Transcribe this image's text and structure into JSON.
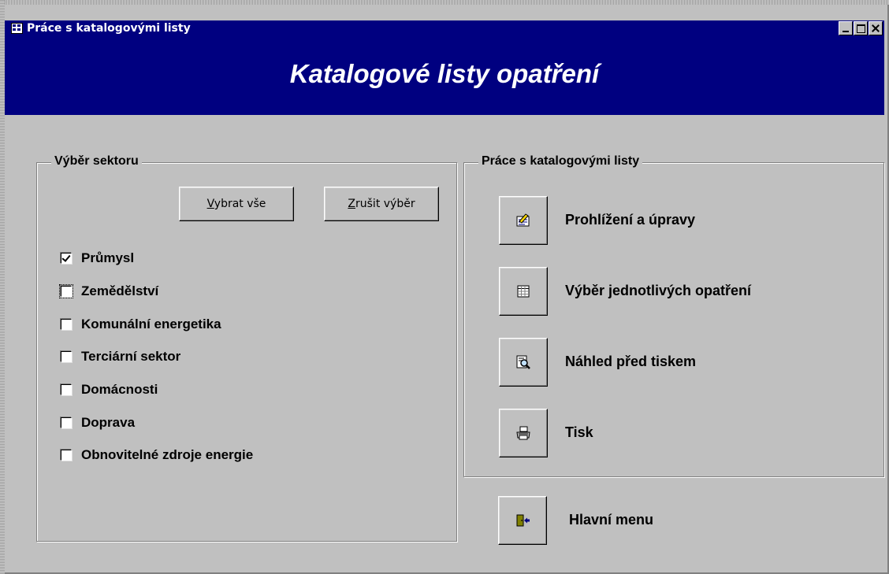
{
  "window": {
    "title": "Práce s katalogovými listy",
    "controls": {
      "minimize": "minimize",
      "maximize": "maximize",
      "close": "close"
    }
  },
  "header": {
    "title": "Katalogové listy opatření"
  },
  "sector_group": {
    "label": "Výběr sektoru",
    "select_all": {
      "accel": "V",
      "rest": "ybrat vše"
    },
    "clear_selection": {
      "accel": "Z",
      "rest": "rušit výběr"
    },
    "items": [
      {
        "label": "Průmysl",
        "checked": true
      },
      {
        "label": "Zemědělství",
        "checked": false
      },
      {
        "label": "Komunální energetika",
        "checked": false
      },
      {
        "label": "Terciární sektor",
        "checked": false
      },
      {
        "label": "Domácnosti",
        "checked": false
      },
      {
        "label": "Doprava",
        "checked": false
      },
      {
        "label": "Obnovitelné zdroje energie",
        "checked": false
      }
    ]
  },
  "catalog_group": {
    "label": "Práce s katalogovými listy",
    "actions": [
      {
        "label": "Prohlížení a úpravy",
        "icon": "edit-form-icon"
      },
      {
        "label": "Výběr jednotlivých opatření",
        "icon": "datasheet-icon"
      },
      {
        "label": "Náhled před tiskem",
        "icon": "print-preview-icon"
      },
      {
        "label": "Tisk",
        "icon": "printer-icon"
      }
    ]
  },
  "main_menu": {
    "label": "Hlavní menu",
    "icon": "exit-door-icon"
  },
  "colors": {
    "title_bar": "#000080",
    "face": "#c0c0c0"
  }
}
